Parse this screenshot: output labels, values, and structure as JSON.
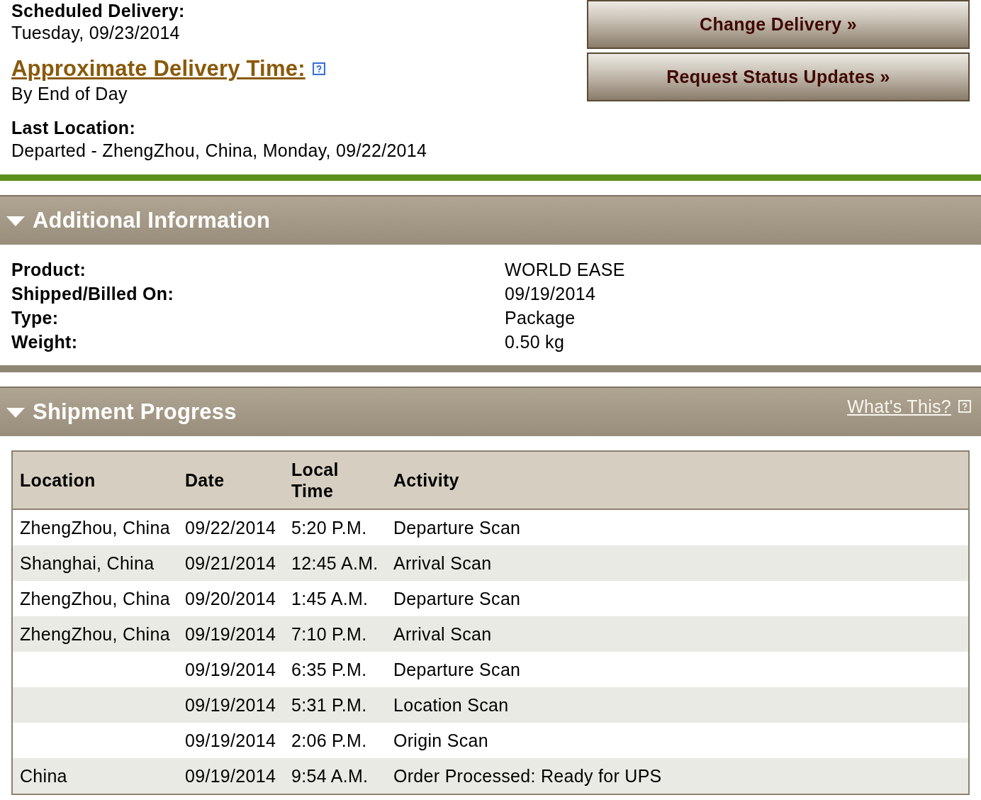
{
  "delivery": {
    "scheduled_label": "Scheduled Delivery:",
    "scheduled_date": "Tuesday, 09/23/2014",
    "approximate_time_link": "Approximate Delivery Time:",
    "approximate_time": "By End of Day",
    "last_location_label": "Last Location:",
    "last_location": "Departed - ZhengZhou, China, Monday, 09/22/2014"
  },
  "actions": [
    {
      "label": "Change Delivery »"
    },
    {
      "label": "Request Status Updates »"
    }
  ],
  "sections": [
    {
      "kind": "details",
      "title": "Additional Information",
      "expanded": true,
      "fields": [
        {
          "label": "Product:",
          "value": "WORLD EASE"
        },
        {
          "label": "Shipped/Billed On:",
          "value": "09/19/2014"
        },
        {
          "label": "Type:",
          "value": "Package"
        },
        {
          "label": "Weight:",
          "value": "0.50 kg"
        }
      ]
    },
    {
      "kind": "progress",
      "title": "Shipment Progress",
      "expanded": true,
      "help_link": "What's This?",
      "table": {
        "columns": [
          "Location",
          "Date",
          "Local Time",
          "Activity"
        ],
        "rows": [
          {
            "location": "ZhengZhou, China",
            "date": "09/22/2014",
            "local_time": "5:20 P.M.",
            "activity": "Departure Scan"
          },
          {
            "location": "Shanghai, China",
            "date": "09/21/2014",
            "local_time": "12:45 A.M.",
            "activity": "Arrival Scan"
          },
          {
            "location": "ZhengZhou, China",
            "date": "09/20/2014",
            "local_time": "1:45 A.M.",
            "activity": "Departure Scan"
          },
          {
            "location": "ZhengZhou, China",
            "date": "09/19/2014",
            "local_time": "7:10 P.M.",
            "activity": "Arrival Scan"
          },
          {
            "date": "09/19/2014",
            "local_time": "6:35 P.M.",
            "activity": "Departure Scan"
          },
          {
            "date": "09/19/2014",
            "local_time": "5:31 P.M.",
            "activity": "Location Scan"
          },
          {
            "date": "09/19/2014",
            "local_time": "2:06 P.M.",
            "activity": "Origin Scan"
          },
          {
            "location": "China",
            "date": "09/19/2014",
            "local_time": "9:54 A.M.",
            "activity": "Order Processed: Ready for UPS"
          }
        ]
      }
    }
  ]
}
